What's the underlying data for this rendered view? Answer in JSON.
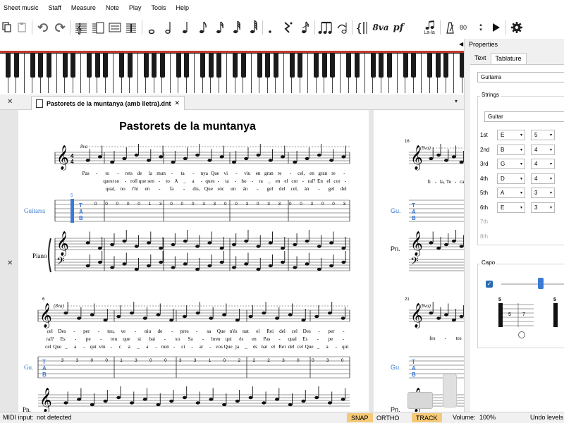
{
  "menu": [
    "Sheet music",
    "Staff",
    "Measure",
    "Note",
    "Play",
    "Tools",
    "Help"
  ],
  "toolbar": {
    "notes": [
      "𝅝",
      "𝅗𝅥",
      "♩",
      "♪",
      "♬",
      "♬",
      "𝅘𝅥𝅲",
      ".",
      "𝄾",
      "𝄽"
    ],
    "ottava": "8va",
    "dynamic": "pf",
    "lyrics_label": "La-la",
    "tempo_value": "80"
  },
  "document": {
    "tab_title": "Pastorets de la muntanya (amb lletra).dnt",
    "title": "Pastorets de la muntanya",
    "instruments_full": [
      "Guitarra",
      "Piano"
    ],
    "instruments_short": [
      "Gu.",
      "Pn."
    ],
    "ottava_marks": [
      "8va",
      "(8va)"
    ],
    "measure_numbers": [
      "6",
      "16",
      "21"
    ],
    "system1": {
      "lyrics1": [
        "Pas",
        "-",
        "to",
        "-",
        "rets",
        "de",
        "la",
        "mun",
        "-",
        "ta",
        "-",
        "nya",
        "Que",
        "vi",
        "-",
        "viu",
        "en",
        "gran",
        "re",
        "-",
        "cel,",
        "en",
        "gran",
        "re",
        "-"
      ],
      "lyrics2": [
        "quest",
        "so",
        "-",
        "roll",
        "que",
        "sen",
        "-",
        "to",
        "A",
        "_",
        "a",
        "-",
        "ques",
        "-",
        "ta",
        "-",
        "ho",
        "-",
        "ra",
        "_",
        "en",
        "el",
        "cor",
        "-",
        "ral?",
        "En",
        "el",
        "cor",
        "-"
      ],
      "lyrics3": [
        "qual,",
        "no",
        "t'hi",
        "en",
        "-",
        "fa",
        "-",
        "dis,",
        "Que",
        "sóc",
        "un",
        "àn",
        "-",
        "gel",
        "del",
        "cel,",
        "àn",
        "-",
        "gel",
        "del"
      ],
      "tab_first": "5",
      "tab_numbers": [
        "0",
        "0",
        "0",
        "0",
        "0",
        "1",
        "3",
        "0",
        "0",
        "0",
        "3",
        "3",
        "0",
        "0",
        "3",
        "0",
        "3",
        "3",
        "0",
        "0",
        "3",
        "0",
        "0",
        "3"
      ]
    },
    "system2": {
      "lyrics1": [
        "cel",
        "Des",
        "-",
        "per",
        "-",
        "teu,",
        "ve",
        "-",
        "niu",
        "de",
        "-",
        "pres",
        "-",
        "sa",
        "Que",
        "n'és",
        "nat",
        "el",
        "Rei",
        "del",
        "cel",
        "Des",
        "-",
        "per",
        "-"
      ],
      "lyrics2": [
        "ral?",
        "Es",
        "-",
        "pe",
        "-",
        "reu",
        "que",
        "si",
        "bai",
        "-",
        "xo",
        "Sa",
        "-",
        "breu",
        "qui",
        "és",
        "en",
        "Pas",
        "-",
        "qual",
        "Es",
        "-",
        "pe",
        "-"
      ],
      "lyrics3": [
        "cel",
        "Que",
        "_",
        "a",
        "-",
        "quí",
        "vin",
        "-",
        "c",
        "a",
        "_",
        "a",
        "-",
        "nun",
        "-",
        "ci",
        "-",
        "ar",
        "-",
        "vos",
        "Que",
        "ja",
        "_",
        "és",
        "nat",
        "el",
        "Rei",
        "del",
        "cel",
        "Que",
        "_",
        "a",
        "-",
        "quí"
      ],
      "tab_numbers": [
        "3",
        "3",
        "0",
        "0",
        "1",
        "3",
        "0",
        "0",
        "3",
        "3",
        "1",
        "0",
        "2",
        "2",
        "2",
        "3",
        "0",
        "0",
        "3",
        "0"
      ]
    },
    "right_lyrics": [
      "fi",
      "-",
      "la,",
      "To",
      "-",
      "ca",
      "fes",
      "-",
      "tes"
    ]
  },
  "panel": {
    "title": "Properties",
    "tabs": [
      "Text",
      "Tablature"
    ],
    "instrument": "Guitarra",
    "strings_label": "Strings",
    "strings_preset": "Guitar",
    "strings": [
      {
        "label": "1st",
        "note": "E",
        "octave": "5",
        "enabled": true
      },
      {
        "label": "2nd",
        "note": "B",
        "octave": "4",
        "enabled": true
      },
      {
        "label": "3rd",
        "note": "G",
        "octave": "4",
        "enabled": true
      },
      {
        "label": "4th",
        "note": "D",
        "octave": "4",
        "enabled": true
      },
      {
        "label": "5th",
        "note": "A",
        "octave": "3",
        "enabled": true
      },
      {
        "label": "6th",
        "note": "E",
        "octave": "3",
        "enabled": true
      },
      {
        "label": "7th",
        "enabled": false
      },
      {
        "label": "8th",
        "enabled": false
      }
    ],
    "capo_label": "Capo",
    "capo_enabled": true,
    "fret_labels": [
      "5",
      "5",
      "7",
      "5"
    ]
  },
  "statusbar": {
    "midi_label": "MIDI input:",
    "midi_value": "not detected",
    "snap": "SNAP",
    "ortho": "ORTHO",
    "track": "TRACK",
    "volume_label": "Volume:",
    "volume_value": "100%",
    "undo_label": "Undo levels"
  },
  "colors": {
    "accent_blue": "#2b6cb0",
    "tab_blue": "#3a7bd5",
    "keyboard_red": "#c0392b",
    "status_on": "#f5c978"
  }
}
